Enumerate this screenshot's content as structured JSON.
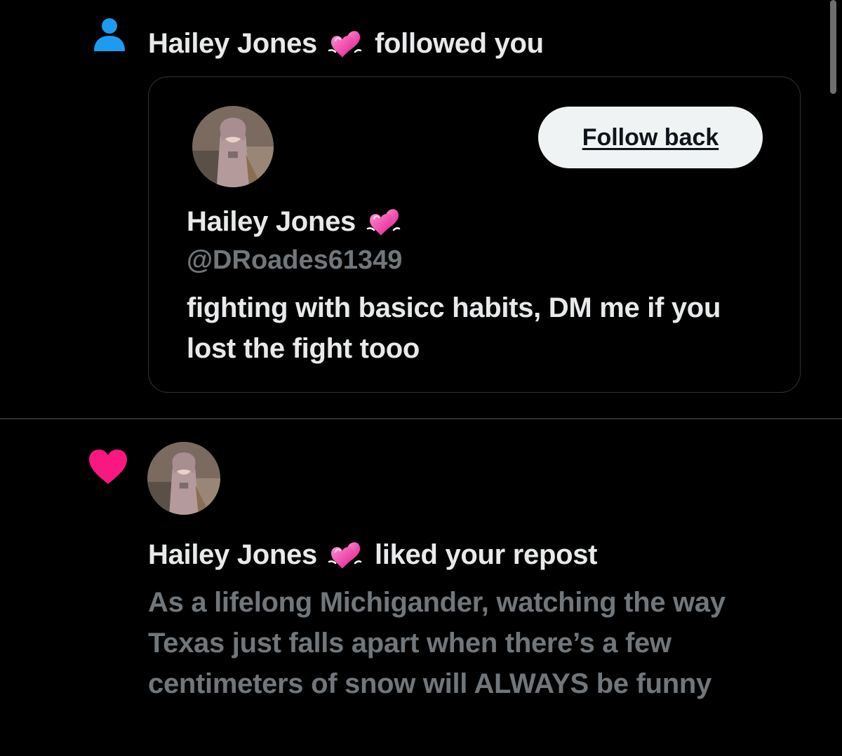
{
  "colors": {
    "background": "#000000",
    "text_primary": "#e7e9ea",
    "text_secondary": "#71767b",
    "follow_icon": "#1d9bf0",
    "like_icon": "#f91880",
    "button_bg": "#eff3f4",
    "border": "#2f3336"
  },
  "notifications": [
    {
      "type": "follow",
      "icon": "person-icon",
      "actor_name": "Hailey Jones",
      "actor_emoji": "two-hearts-emoji",
      "action_text": "followed you",
      "card": {
        "follow_button_label": "Follow back",
        "name": "Hailey Jones",
        "handle": "@DRoades61349",
        "bio": "fighting with basicc habits, DM me if you lost the fight tooo"
      }
    },
    {
      "type": "like",
      "icon": "heart-icon",
      "actor_name": "Hailey Jones",
      "actor_emoji": "two-hearts-emoji",
      "action_text": "liked your repost",
      "post_text": "As a lifelong Michigander, watching the way Texas just falls apart when there’s a few centimeters of snow will ALWAYS be funny"
    }
  ]
}
